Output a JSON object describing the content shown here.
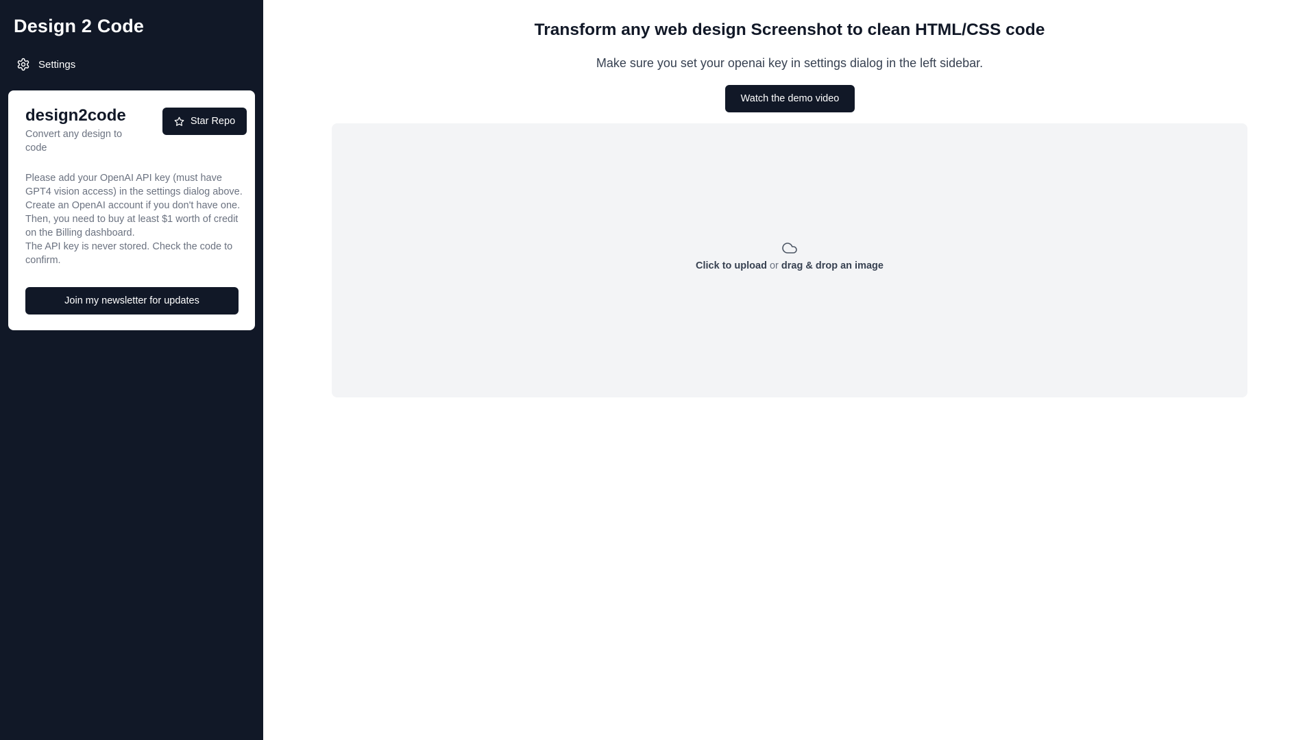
{
  "sidebar": {
    "app_title": "Design 2 Code",
    "settings_label": "Settings",
    "card": {
      "title": "design2code",
      "subtitle": "Convert any design to code",
      "star_button_label": "Star Repo",
      "body_lines": [
        "Please add your OpenAI API key (must have GPT4 vision access) in the settings dialog above.",
        "Create an OpenAI account if you don't have one. Then, you need to buy at least $1 worth of credit on the Billing dashboard.",
        "The API key is never stored. Check the code to confirm."
      ],
      "newsletter_button_label": "Join my newsletter for updates"
    }
  },
  "main": {
    "heading": "Transform any web design Screenshot to clean HTML/CSS code",
    "subheading": "Make sure you set your openai key in settings dialog in the left sidebar.",
    "demo_button_label": "Watch the demo video",
    "dropzone": {
      "click_text": "Click to upload",
      "or_text": "or",
      "drag_text": "drag & drop an image"
    }
  },
  "icons": {
    "settings": "gear-icon",
    "star": "star-icon",
    "upload": "cloud-icon"
  },
  "colors": {
    "sidebar_bg": "#111827",
    "primary_button": "#111827",
    "dropzone_bg": "#f3f4f6"
  }
}
